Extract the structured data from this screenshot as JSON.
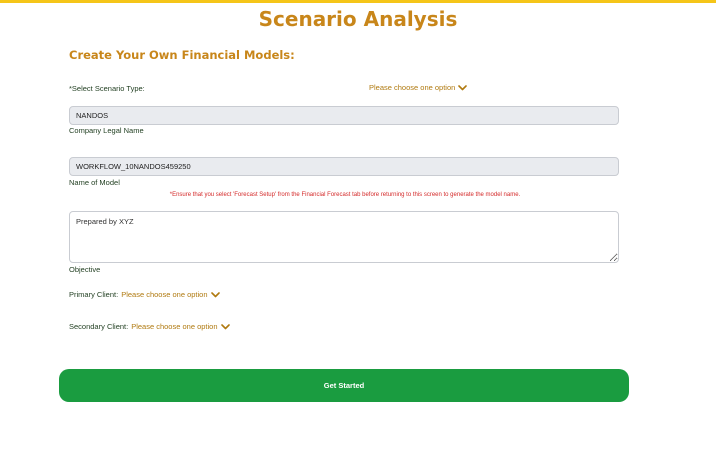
{
  "header": {
    "title": "Scenario Analysis"
  },
  "form": {
    "section_title": "Create Your Own Financial Models:",
    "scenario_type": {
      "label": "*Select Scenario Type:",
      "dropdown_text": "Please choose one option"
    },
    "company_name": {
      "value": "NANDOS",
      "label": "Company Legal Name"
    },
    "model_name": {
      "value": "WORKFLOW_10NANDOS459250",
      "label": "Name of Model",
      "warning": "*Ensure that you select 'Forecast Setup' from the Financial Forecast tab before returning to this screen to generate the model name."
    },
    "objective": {
      "value": "Prepared by XYZ",
      "label": "Objective"
    },
    "primary_client": {
      "label": "Primary Client:",
      "dropdown_text": "Please choose one option"
    },
    "secondary_client": {
      "label": "Secondary Client:",
      "dropdown_text": "Please choose one option"
    },
    "submit_label": "Get Started"
  },
  "colors": {
    "accent": "#c8861a",
    "top_bar": "#f5c518",
    "button": "#1a9c40",
    "warning": "#d42a2a"
  },
  "icons": {
    "dropdown": "chevron-down-icon"
  }
}
